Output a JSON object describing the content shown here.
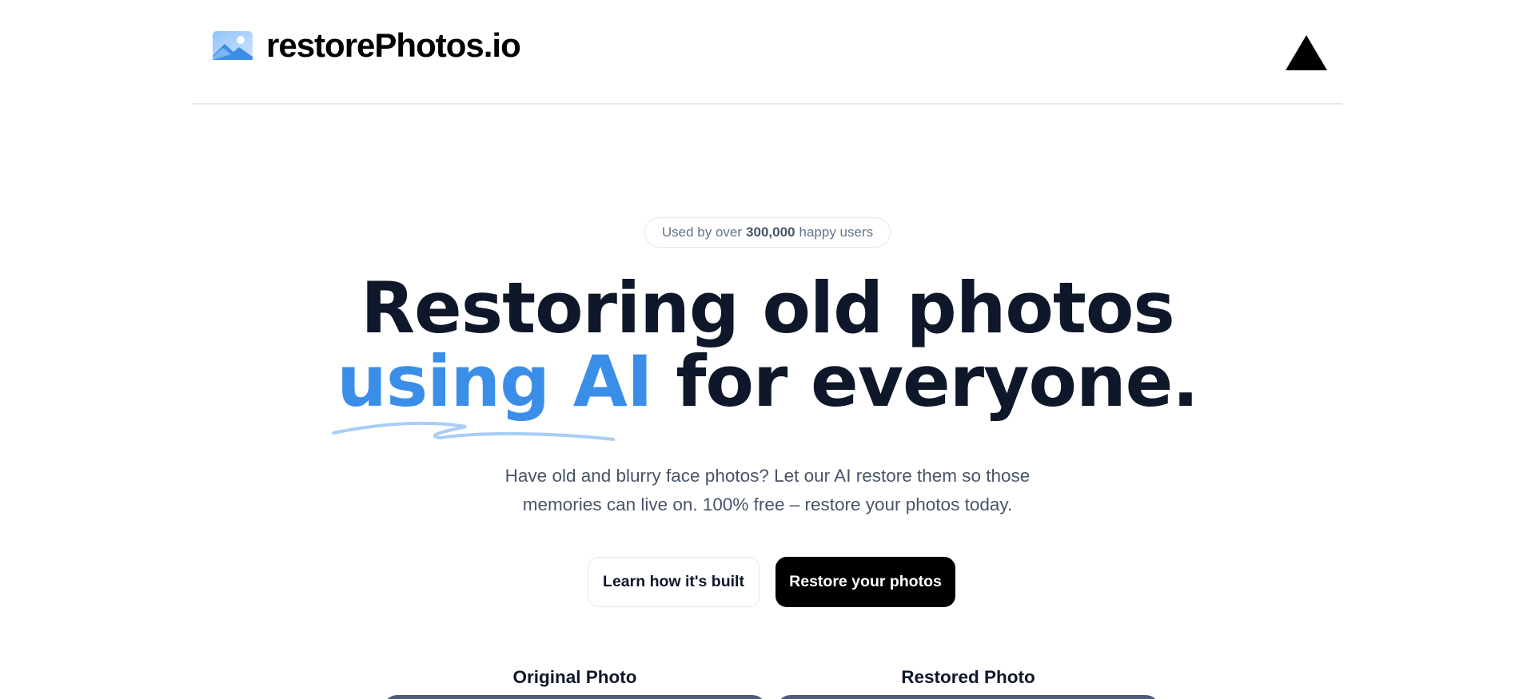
{
  "header": {
    "brand_name": "restorePhotos.io",
    "logo_icon": "image-icon",
    "vercel_icon": "triangle-icon"
  },
  "badge": {
    "prefix": "Used by over",
    "count": "300,000",
    "suffix": "happy users"
  },
  "hero": {
    "title_line1": "Restoring old photos",
    "title_accent": "using AI",
    "title_rest": "for everyone.",
    "subtitle": "Have old and blurry face photos? Let our AI restore them so those memories can live on. 100% free – restore your photos today."
  },
  "actions": {
    "learn_label": "Learn how it's built",
    "restore_label": "Restore your photos"
  },
  "comparison": {
    "original_label": "Original Photo",
    "restored_label": "Restored Photo"
  },
  "colors": {
    "accent": "#3b8ee8",
    "text": "#0f172a",
    "muted": "#475569",
    "primary_button": "#000000"
  }
}
